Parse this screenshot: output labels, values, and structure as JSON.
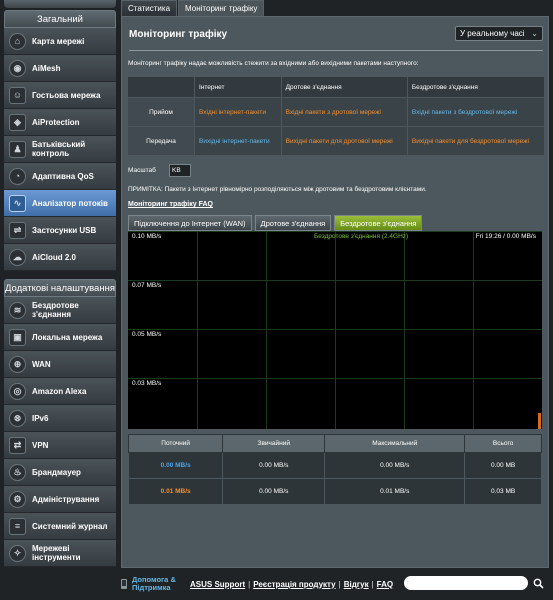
{
  "sidebar": {
    "top_stub": "",
    "general_header": "Загальний",
    "general_items": [
      {
        "label": "Карта мережі",
        "icon": "network-map-icon"
      },
      {
        "label": "AiMesh",
        "icon": "aimesh-icon"
      },
      {
        "label": "Гостьова мережа",
        "icon": "guest-network-icon"
      },
      {
        "label": "AiProtection",
        "icon": "aiprotection-icon"
      },
      {
        "label": "Батьківський контроль",
        "icon": "parental-control-icon"
      },
      {
        "label": "Адаптивна QoS",
        "icon": "adaptive-qos-icon"
      },
      {
        "label": "Аналізатор потоків",
        "icon": "traffic-analyzer-icon"
      },
      {
        "label": "Застосунки USB",
        "icon": "usb-apps-icon"
      },
      {
        "label": "AiCloud 2.0",
        "icon": "aicloud-icon"
      }
    ],
    "advanced_header": "Додаткові налаштування",
    "advanced_items": [
      {
        "label": "Бездротове з'єднання",
        "icon": "wireless-icon"
      },
      {
        "label": "Локальна мережа",
        "icon": "lan-icon"
      },
      {
        "label": "WAN",
        "icon": "wan-icon"
      },
      {
        "label": "Amazon Alexa",
        "icon": "alexa-icon"
      },
      {
        "label": "IPv6",
        "icon": "ipv6-icon"
      },
      {
        "label": "VPN",
        "icon": "vpn-icon"
      },
      {
        "label": "Брандмауер",
        "icon": "firewall-icon"
      },
      {
        "label": "Адміністрування",
        "icon": "administration-icon"
      },
      {
        "label": "Системний журнал",
        "icon": "system-log-icon"
      },
      {
        "label": "Мережеві інструменти",
        "icon": "network-tools-icon"
      }
    ]
  },
  "tabs": [
    "Статистика",
    "Моніторинг трафіку"
  ],
  "page": {
    "title": "Моніторинг трафіку",
    "mode_select": "У реальному часі",
    "description": "Моніторинг трафіку надає можливість стежити за вхідними або вихідними пакетами наступного:",
    "table": {
      "headers": [
        "",
        "Інтернет",
        "Дротове з'єднання",
        "Бездротове з'єднання"
      ],
      "rows": [
        {
          "label": "Прийом",
          "internet": "Вхідні інтернет-пакети",
          "wired": "Вхідні пакети з дротової мережі",
          "wireless": "Вхідні пакети з бездротової мережі"
        },
        {
          "label": "Передача",
          "internet": "Вихідні інтернет-пакети",
          "wired": "Вихідні пакети для дротової мережі",
          "wireless": "Вихідні пакети для бездротової мережі"
        }
      ]
    },
    "scale_label": "Масштаб",
    "scale_value": "KB",
    "note": "ПРИМІТКА: Пакети з Інтернет рівномірно розподіляються між дротовим та бездротовим клієнтами.",
    "faq": "Моніторинг трафіку FAQ",
    "graph_tabs": [
      "Підключення до Інтернет (WAN)",
      "Дротове з'єднання",
      "Бездротове з'єднання"
    ],
    "graph": {
      "title": "Бездротове з'єднання (2.4GHz)",
      "readout": "Fri 19:26 / 0.00 MB/s",
      "y_labels": [
        "0.10 MB/s",
        "0.07 MB/s",
        "0.05 MB/s",
        "0.03 MB/s"
      ]
    },
    "stats": {
      "headers": [
        "Поточний",
        "Звичайний",
        "Максимальний",
        "Всього"
      ],
      "rows": [
        [
          "0.00 MB/s",
          "0.00 MB/s",
          "0.00 MB/s",
          "0.00 MB"
        ],
        [
          "0.01 MB/s",
          "0.00 MB/s",
          "0.01 MB/s",
          "0.03 MB"
        ]
      ]
    }
  },
  "footer": {
    "help": "Допомога & Підтримка",
    "links": [
      "ASUS Support",
      "Реєстрація продукту",
      "Відгук",
      "FAQ"
    ],
    "separators": [
      "|",
      "|",
      "|"
    ]
  },
  "colors": {
    "accent_orange": "#f38f2c",
    "accent_blue": "#64b8e8",
    "active_menu": "#3f6ea9",
    "active_graph_tab": "#668c16"
  }
}
